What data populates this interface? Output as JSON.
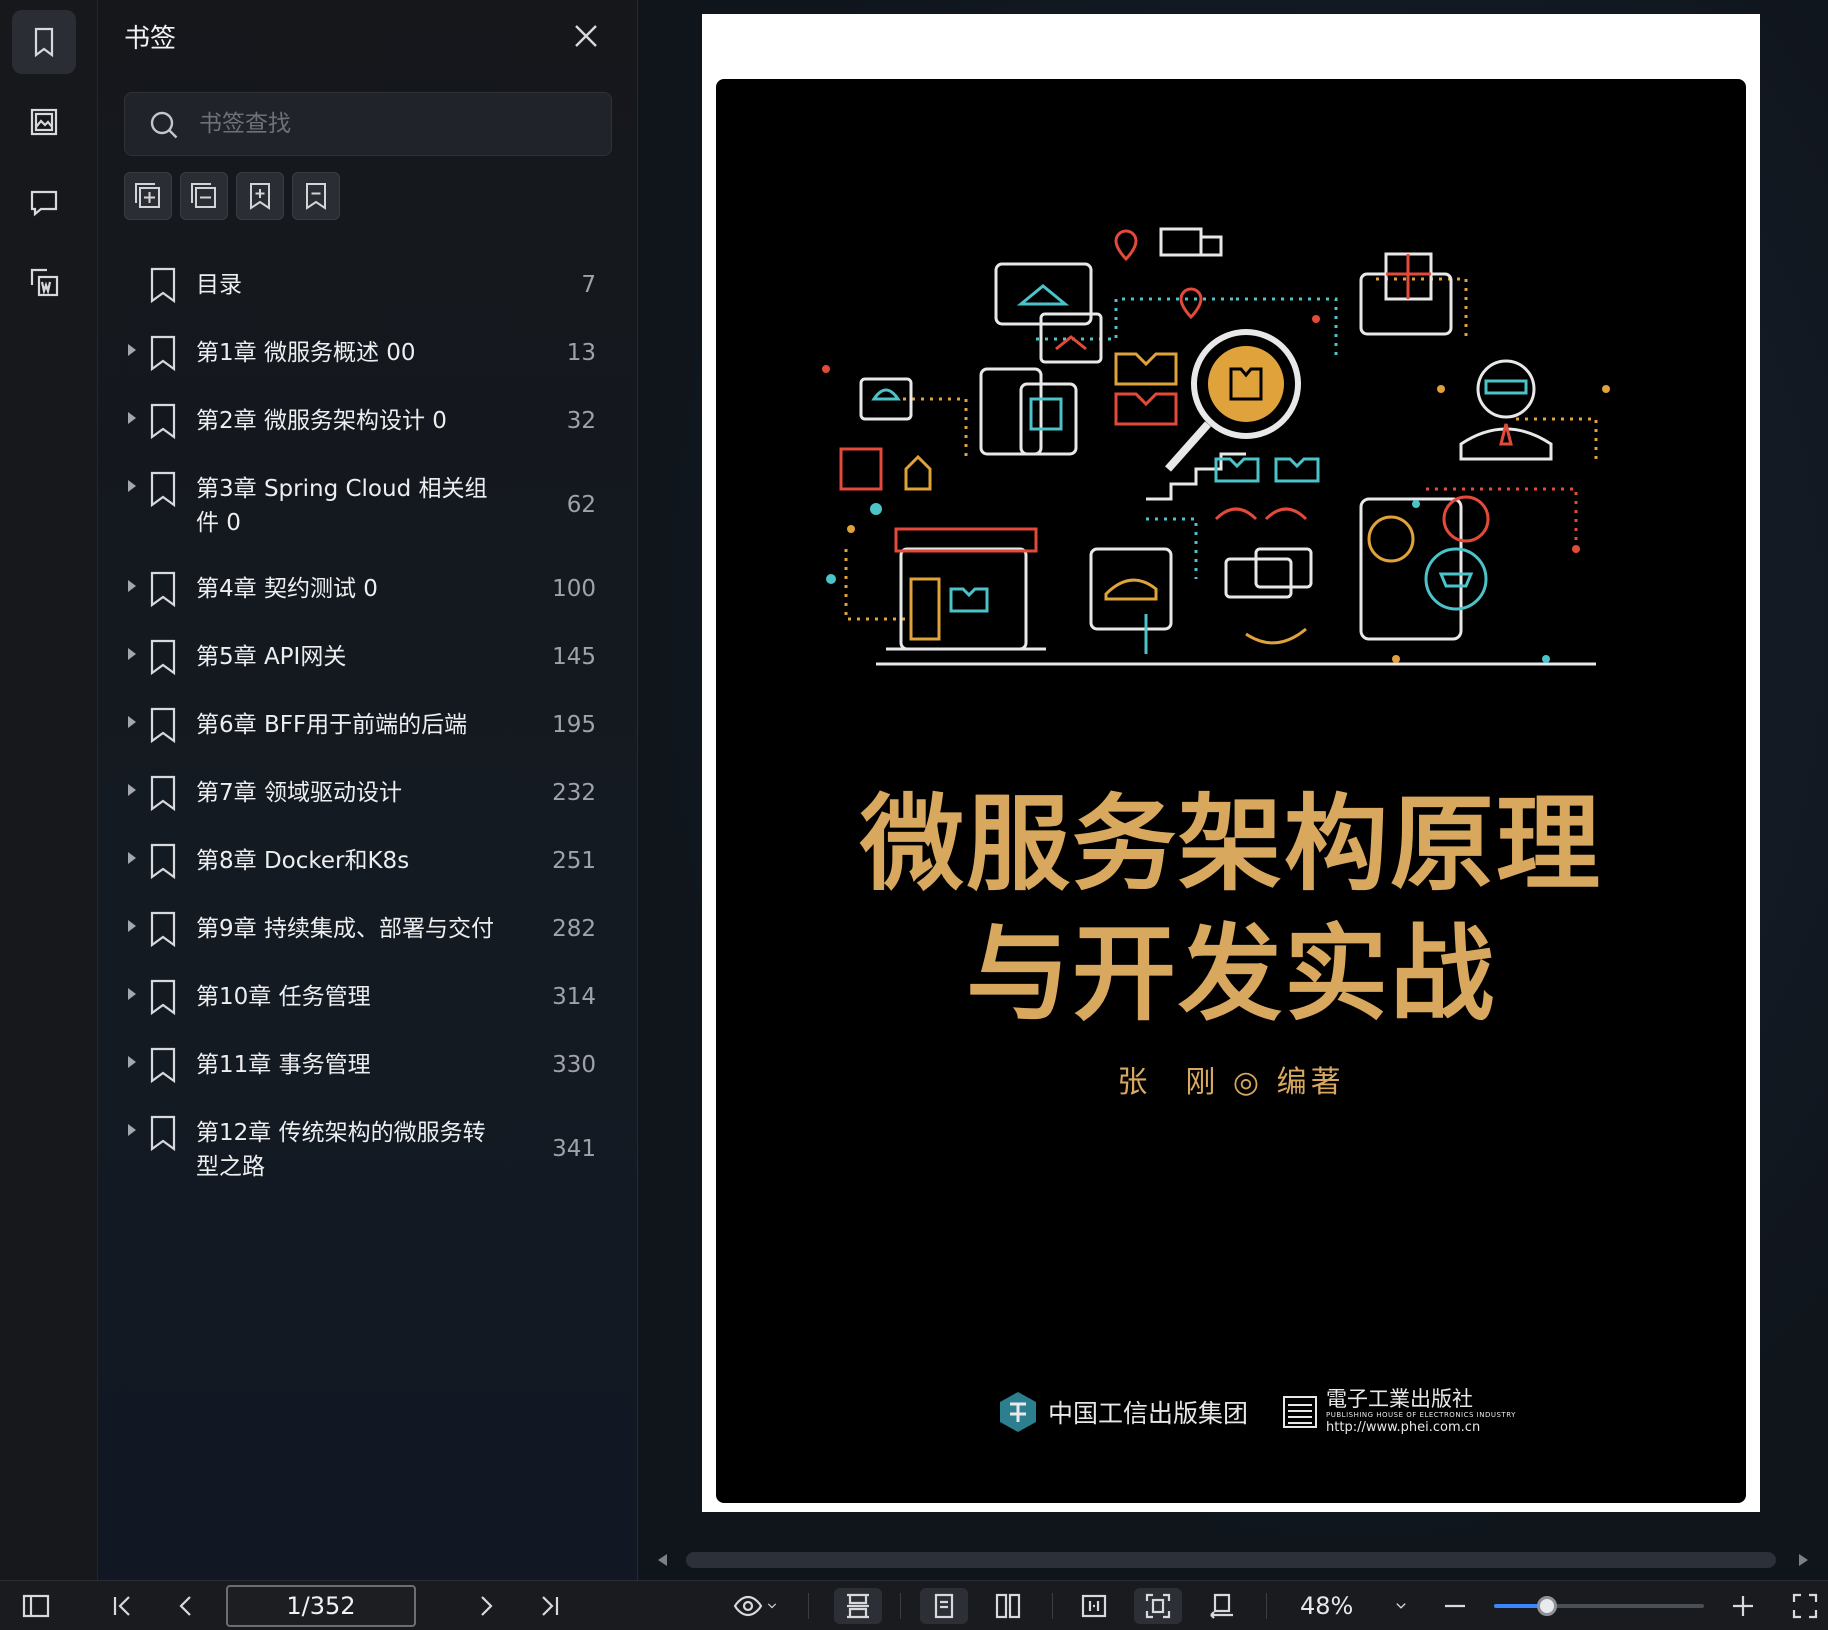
{
  "rail": {
    "items": [
      {
        "name": "bookmark",
        "active": true
      },
      {
        "name": "thumbnail",
        "active": false
      },
      {
        "name": "comment",
        "active": false
      },
      {
        "name": "convert",
        "active": false
      }
    ]
  },
  "panel": {
    "title": "书签",
    "search_placeholder": "书签查找",
    "bookmarks": [
      {
        "label": "目录",
        "page": "7",
        "expandable": false
      },
      {
        "label": "第1章 微服务概述 00",
        "page": "13",
        "expandable": true
      },
      {
        "label": "第2章 微服务架构设计 0",
        "page": "32",
        "expandable": true
      },
      {
        "label": "第3章 Spring Cloud 相关组件 0",
        "page": "62",
        "expandable": true
      },
      {
        "label": "第4章 契约测试 0",
        "page": "100",
        "expandable": true
      },
      {
        "label": "第5章 API网关",
        "page": "145",
        "expandable": true
      },
      {
        "label": "第6章 BFF用于前端的后端",
        "page": "195",
        "expandable": true
      },
      {
        "label": "第7章 领域驱动设计",
        "page": "232",
        "expandable": true
      },
      {
        "label": "第8章 Docker和K8s",
        "page": "251",
        "expandable": true
      },
      {
        "label": "第9章 持续集成、部署与交付",
        "page": "282",
        "expandable": true
      },
      {
        "label": "第10章 任务管理",
        "page": "314",
        "expandable": true
      },
      {
        "label": "第11章 事务管理",
        "page": "330",
        "expandable": true
      },
      {
        "label": "第12章 传统架构的微服务转型之路",
        "page": "341",
        "expandable": true
      }
    ]
  },
  "cover": {
    "title_line1": "微服务架构原理",
    "title_line2": "与开发实战",
    "author": "张　刚 ◎ 编著",
    "publisher1": "中国工信出版集团",
    "publisher2_name": "電子工業出版社",
    "publisher2_sub": "PUBLISHING HOUSE OF ELECTRONICS INDUSTRY",
    "publisher2_url": "http://www.phei.com.cn",
    "title_color": "#d8a85f"
  },
  "toolbar": {
    "page_indicator": "1/352",
    "zoom_text": "48%",
    "zoom_level": 0.25
  },
  "colors": {
    "accent": "#3a86ff",
    "panel_bg": "#15171b"
  }
}
